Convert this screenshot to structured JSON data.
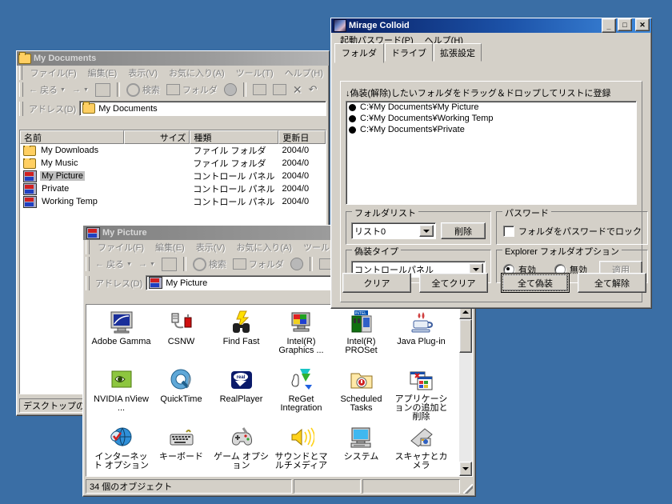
{
  "desktop": {
    "background": "#3a6ea5"
  },
  "mydocs_window": {
    "title": "My Documents",
    "icon": "folder-icon",
    "titlebar_buttons": {
      "minimize": "_",
      "maximize": "□",
      "close": "✕"
    },
    "menu": [
      "ファイル(F)",
      "編集(E)",
      "表示(V)",
      "お気に入り(A)",
      "ツール(T)",
      "ヘルプ(H)"
    ],
    "toolbar": {
      "back": "戻る",
      "forward": "",
      "up_icon": "up-folder-icon",
      "search": "検索",
      "folders": "フォルダ",
      "history_icon": "history-icon",
      "move_icon": "move-to-icon",
      "copy_icon": "copy-to-icon",
      "delete_icon": "delete-icon",
      "undo_icon": "undo-icon"
    },
    "address": {
      "label": "アドレス(D)",
      "value": "My Documents",
      "icon": "folder-icon"
    },
    "columns": [
      "名前",
      "サイズ",
      "種類",
      "更新日"
    ],
    "rows": [
      {
        "name": "My Downloads",
        "icon": "folder-icon",
        "size": "",
        "type": "ファイル フォルダ",
        "modified": "2004/0",
        "selected": false
      },
      {
        "name": "My Music",
        "icon": "folder-icon",
        "size": "",
        "type": "ファイル フォルダ",
        "modified": "2004/0",
        "selected": false
      },
      {
        "name": "My Picture",
        "icon": "control-panel-icon",
        "size": "",
        "type": "コントロール パネル",
        "modified": "2004/0",
        "selected": true
      },
      {
        "name": "Private",
        "icon": "control-panel-icon",
        "size": "",
        "type": "コントロール パネル",
        "modified": "2004/0",
        "selected": false
      },
      {
        "name": "Working Temp",
        "icon": "control-panel-icon",
        "size": "",
        "type": "コントロール パネル",
        "modified": "2004/0",
        "selected": false
      }
    ],
    "status": "デスクトップのデ"
  },
  "mypicture_window": {
    "title": "My Picture",
    "icon": "control-panel-icon",
    "menu": [
      "ファイル(F)",
      "編集(E)",
      "表示(V)",
      "お気に入り(A)",
      "ツール"
    ],
    "toolbar": {
      "back": "戻る",
      "search": "検索",
      "folders": "フォルダ",
      "history_icon": "history-icon",
      "move_icon": "move-to-icon"
    },
    "address": {
      "label": "アドレス(D)",
      "value": "My Picture",
      "icon": "control-panel-icon"
    },
    "items": [
      {
        "label": "Adobe Gamma",
        "icon": "monitor-curve-icon"
      },
      {
        "label": "CSNW",
        "icon": "network-plug-icon"
      },
      {
        "label": "Find Fast",
        "icon": "binoculars-bolt-icon"
      },
      {
        "label": "Intel(R) Graphics ...",
        "icon": "intel-graphics-icon"
      },
      {
        "label": "Intel(R) PROSet",
        "icon": "intel-proset-icon"
      },
      {
        "label": "Java Plug-in",
        "icon": "java-coffee-icon"
      },
      {
        "label": "NVIDIA nView ...",
        "icon": "nvidia-eye-icon"
      },
      {
        "label": "QuickTime",
        "icon": "quicktime-q-icon"
      },
      {
        "label": "RealPlayer",
        "icon": "realplayer-icon"
      },
      {
        "label": "ReGet Integration",
        "icon": "reget-hand-icon"
      },
      {
        "label": "Scheduled Tasks",
        "icon": "scheduled-tasks-icon"
      },
      {
        "label": "アプリケーションの追加と削除",
        "icon": "add-remove-programs-icon"
      },
      {
        "label": "インターネット オプション",
        "icon": "internet-options-icon"
      },
      {
        "label": "キーボード",
        "icon": "keyboard-icon"
      },
      {
        "label": "ゲーム オプション",
        "icon": "gamepad-icon"
      },
      {
        "label": "サウンドとマルチメディア",
        "icon": "speaker-icon"
      },
      {
        "label": "システム",
        "icon": "computer-icon"
      },
      {
        "label": "スキャナとカメラ",
        "icon": "scanner-camera-icon"
      }
    ],
    "status": {
      "objects": "34 個のオブジェクト",
      "pane2": "",
      "pane3": ""
    }
  },
  "mirage_window": {
    "title": "Mirage Colloid",
    "icon": "mirage-app-icon",
    "titlebar_buttons": {
      "minimize": "_",
      "maximize": "□",
      "close": "✕"
    },
    "menu": [
      "起動パスワード(P)",
      "ヘルプ(H)"
    ],
    "tabs": [
      {
        "label": "フォルダ",
        "selected": true
      },
      {
        "label": "ドライブ",
        "selected": false
      },
      {
        "label": "拡張設定",
        "selected": false
      }
    ],
    "hint": "↓偽装(解除)したいフォルダをドラッグ＆ドロップしてリストに登録",
    "folder_list": [
      "C:¥My Documents¥My Picture",
      "C:¥My Documents¥Working Temp",
      "C:¥My Documents¥Private"
    ],
    "folderlist_group": {
      "title": "フォルダリスト",
      "combo_value": "リスト0",
      "delete_button": "削除"
    },
    "password_group": {
      "title": "パスワード",
      "checkbox_label": "フォルダをパスワードでロック",
      "checked": false
    },
    "disguise_group": {
      "title": "偽装タイプ",
      "combo_value": "コントロールパネル"
    },
    "explorer_group": {
      "title": "Explorer フォルダオプション",
      "enabled_label": "有効",
      "disabled_label": "無効",
      "selected": "有効",
      "apply_button": "適用",
      "apply_disabled": true
    },
    "buttons": [
      {
        "label": "クリア",
        "default": false
      },
      {
        "label": "全てクリア",
        "default": false
      },
      {
        "label": "全て偽装",
        "default": true
      },
      {
        "label": "全て解除",
        "default": false
      }
    ]
  }
}
